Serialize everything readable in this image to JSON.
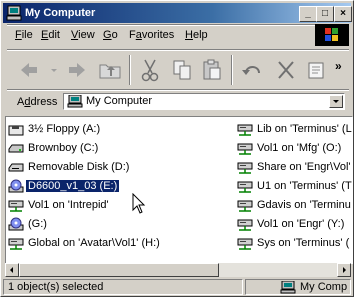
{
  "window": {
    "title": "My Computer",
    "minimize_label": "_",
    "maximize_label": "□",
    "close_label": "×"
  },
  "menubar": {
    "items": [
      {
        "label": "File",
        "underline": "F",
        "rest": "ile"
      },
      {
        "label": "Edit",
        "underline": "E",
        "rest": "dit"
      },
      {
        "label": "View",
        "underline": "V",
        "rest": "iew"
      },
      {
        "label": "Go",
        "underline": "G",
        "rest": "o"
      },
      {
        "label": "Favorites",
        "underline": "a",
        "pre": "F",
        "rest": "vorites"
      },
      {
        "label": "Help",
        "underline": "H",
        "rest": "elp"
      }
    ]
  },
  "toolbar": {
    "overflow_label": "»",
    "buttons": [
      "back",
      "forward",
      "up",
      "cut",
      "copy",
      "paste",
      "undo",
      "delete",
      "properties"
    ]
  },
  "address": {
    "label": "Address",
    "label_underline": "d",
    "value": "My Computer"
  },
  "items_left": [
    {
      "label": "3½ Floppy (A:)",
      "icon": "floppy-drive-icon"
    },
    {
      "label": "Brownboy (C:)",
      "icon": "hard-drive-icon"
    },
    {
      "label": "Removable Disk (D:)",
      "icon": "removable-disk-icon"
    },
    {
      "label": "D6600_v1_03 (E:)",
      "icon": "cd-drive-icon",
      "selected": true
    },
    {
      "label": "Vol1 on 'Intrepid'",
      "icon": "network-drive-icon"
    },
    {
      "label": "(G:)",
      "icon": "cd-drive-icon"
    },
    {
      "label": "Global on 'Avatar\\Vol1' (H:)",
      "icon": "network-drive-icon"
    }
  ],
  "items_right": [
    {
      "label": "Lib on 'Terminus' (L",
      "icon": "network-drive-icon"
    },
    {
      "label": "Vol1 on 'Mfg' (O:)",
      "icon": "network-drive-icon"
    },
    {
      "label": "Share on 'Engr\\Vol'",
      "icon": "network-drive-icon"
    },
    {
      "label": "U1 on 'Terminus' (T",
      "icon": "network-drive-icon"
    },
    {
      "label": "Gdavis on 'Terminu",
      "icon": "network-drive-icon"
    },
    {
      "label": "Vol1 on 'Engr' (Y:)",
      "icon": "network-drive-icon"
    },
    {
      "label": "Sys on 'Terminus' (",
      "icon": "network-drive-icon"
    }
  ],
  "status": {
    "selection_text": "1 object(s) selected",
    "location_text": "My Comp"
  },
  "colors": {
    "title_active": "#0a246a",
    "selection": "#0a246a",
    "face": "#d4d0c8"
  }
}
